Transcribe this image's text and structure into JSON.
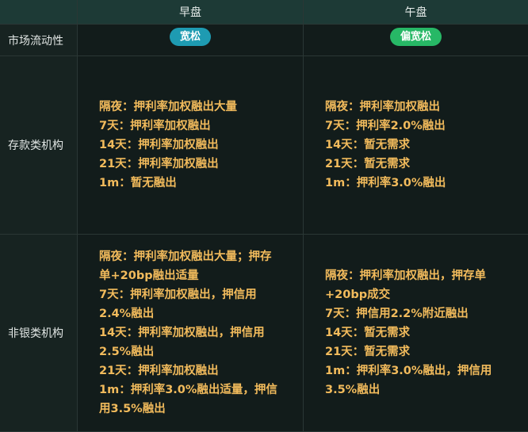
{
  "header": {
    "col_empty": "",
    "col_morning": "早盘",
    "col_afternoon": "午盘"
  },
  "rows": {
    "liquidity": {
      "label": "市场流动性",
      "morning_badge": "宽松",
      "afternoon_badge": "偏宽松"
    },
    "deposit": {
      "label": "存款类机构",
      "morning_lines": [
        "隔夜：押利率加权融出大量",
        "7天：押利率加权融出",
        "14天：押利率加权融出",
        "21天：押利率加权融出",
        "1m：暂无融出"
      ],
      "afternoon_lines": [
        "隔夜：押利率加权融出",
        "7天：押利率2.0%融出",
        "14天：暂无需求",
        "21天：暂无需求",
        "1m：押利率3.0%融出"
      ]
    },
    "nonbank": {
      "label": "非银类机构",
      "morning_lines": [
        "隔夜：押利率加权融出大量；押存",
        "单+20bp融出适量",
        "7天：押利率加权融出，押信用",
        "2.4%融出",
        "14天：押利率加权融出，押信用",
        "2.5%融出",
        "21天：押利率加权融出",
        "1m：押利率3.0%融出适量，押信",
        "用3.5%融出"
      ],
      "afternoon_lines": [
        "隔夜：押利率加权融出，押存单",
        "+20bp成交",
        "7天：押信用2.2%附近融出",
        "14天：暂无需求",
        "21天：暂无需求",
        "1m：押利率3.0%融出，押信用",
        "3.5%融出"
      ]
    }
  },
  "colors": {
    "header_bg": "#1d3a36",
    "text_accent": "#f2bb5c",
    "badge_loose": "#1e9bb2",
    "badge_slightly_loose": "#27b866"
  }
}
